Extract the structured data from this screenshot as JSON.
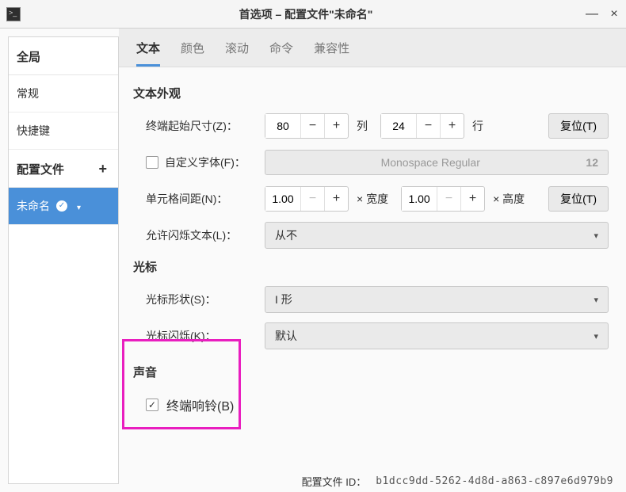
{
  "window": {
    "title": "首选项 – 配置文件\"未命名\"",
    "minimize": "—",
    "close": "×"
  },
  "sidebar": {
    "global_header": "全局",
    "items": [
      "常规",
      "快捷键"
    ],
    "profiles_header": "配置文件",
    "add_icon": "+",
    "active_profile": "未命名"
  },
  "tabs": [
    "文本",
    "颜色",
    "滚动",
    "命令",
    "兼容性"
  ],
  "sections": {
    "text_appearance": "文本外观",
    "cursor": "光标",
    "sound": "声音"
  },
  "rows": {
    "initial_size": {
      "label": "终端起始尺寸(Z)：",
      "cols": "80",
      "cols_unit": "列",
      "rows": "24",
      "rows_unit": "行",
      "reset": "复位(T)"
    },
    "custom_font": {
      "label": "自定义字体(F)：",
      "font_name": "Monospace Regular",
      "font_size": "12"
    },
    "cell_spacing": {
      "label": "单元格间距(N)：",
      "w": "1.00",
      "w_unit": "× 宽度",
      "h": "1.00",
      "h_unit": "× 高度",
      "reset": "复位(T)"
    },
    "blink_text": {
      "label": "允许闪烁文本(L)：",
      "value": "从不"
    },
    "cursor_shape": {
      "label": "光标形状(S)：",
      "value": "I 形"
    },
    "cursor_blink": {
      "label": "光标闪烁(K)：",
      "value": "默认"
    },
    "terminal_bell": {
      "label": "终端响铃(B)"
    }
  },
  "footer": {
    "label": "配置文件 ID：",
    "value": "b1dcc9dd-5262-4d8d-a863-c897e6d979b9"
  }
}
